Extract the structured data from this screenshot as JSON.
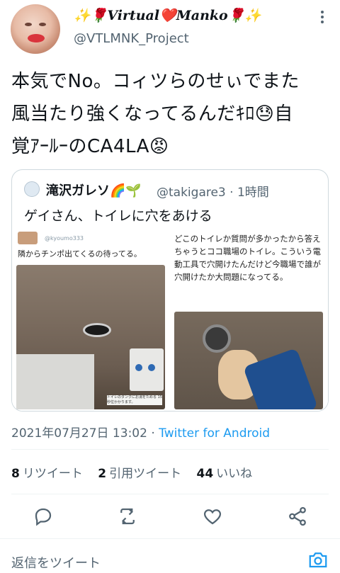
{
  "author": {
    "display_name": "✨🌹Virtual❤️Manko🌹✨",
    "handle": "@VTLMNK_Project"
  },
  "tweet": {
    "line1": "本気でNo。コィツらのせぃでまた",
    "line2": "風当たり強くなってるんだｷﾛ😓自",
    "line3": "覚ｱｰﾙｰのCA4LA😡"
  },
  "quote": {
    "name": "滝沢ガレソ🌈🌱",
    "handle_time": "@takigare3 · 1時間",
    "text": "ゲイさん、トイレに穴をあける",
    "left_image": {
      "handle": "@kyoumo333",
      "caption": "隣からチンポ出てくるの待ってる。",
      "sign": "トイレのタンクにお湯をためる 15秒位かかります。"
    },
    "right_image": {
      "caption": "どこのトイレか質問が多かったから答えちゃうとココ職場のトイレ。こういう電動工具で穴開けたんだけど今職場で誰が穴開けたか大問題になってる。"
    }
  },
  "meta": {
    "datetime": "2021年07月27日 13:02 · ",
    "source": "Twitter for Android"
  },
  "stats": {
    "retweets_count": "8",
    "retweets_label": "リツイート",
    "quotes_count": "2",
    "quotes_label": "引用ツイート",
    "likes_count": "44",
    "likes_label": "いいね"
  },
  "reply": {
    "label": "返信をツイート"
  },
  "colors": {
    "accent": "#1d9bf0",
    "muted": "#536471",
    "text": "#0f1419",
    "border": "#cfd9de"
  }
}
